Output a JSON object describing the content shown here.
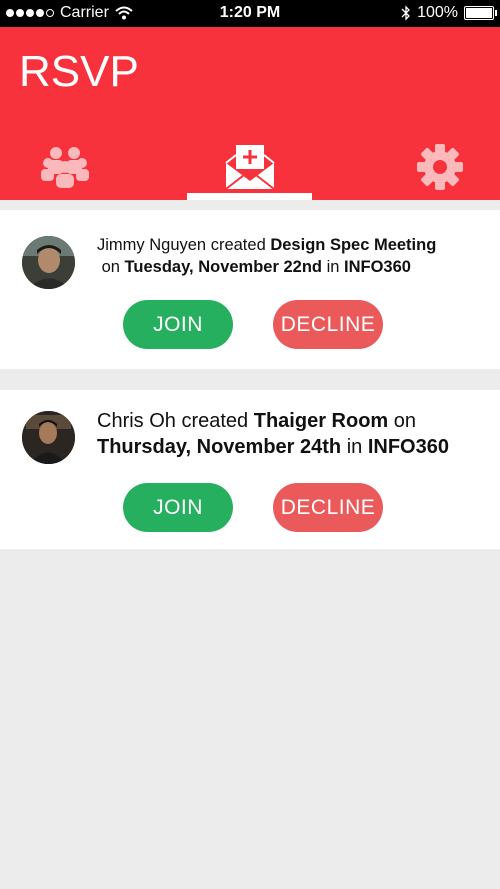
{
  "status_bar": {
    "carrier": "Carrier",
    "time": "1:20 PM",
    "battery": "100%"
  },
  "header": {
    "title": "RSVP",
    "tabs": [
      {
        "icon": "people-icon"
      },
      {
        "icon": "envelope-plus-icon",
        "selected": true
      },
      {
        "icon": "gear-icon"
      }
    ]
  },
  "invitations": [
    {
      "creator": "Jimmy Nguyen",
      "created_text": " created ",
      "event": "Design Spec Meeting",
      "on_text": " on ",
      "date": "Tuesday, November 22nd",
      "in_text": " in ",
      "location": "INFO360",
      "join_label": "JOIN",
      "decline_label": "DECLINE"
    },
    {
      "creator": "Chris Oh",
      "created_text": " created ",
      "event": "Thaiger Room",
      "on_text": " on ",
      "date": "Thursday, November 24th",
      "in_text": " in ",
      "location": "INFO360",
      "join_label": "JOIN",
      "decline_label": "DECLINE"
    }
  ],
  "colors": {
    "header": "#f8323d",
    "join": "#26af5f",
    "decline": "#eb5a5a",
    "background": "#ececec"
  }
}
